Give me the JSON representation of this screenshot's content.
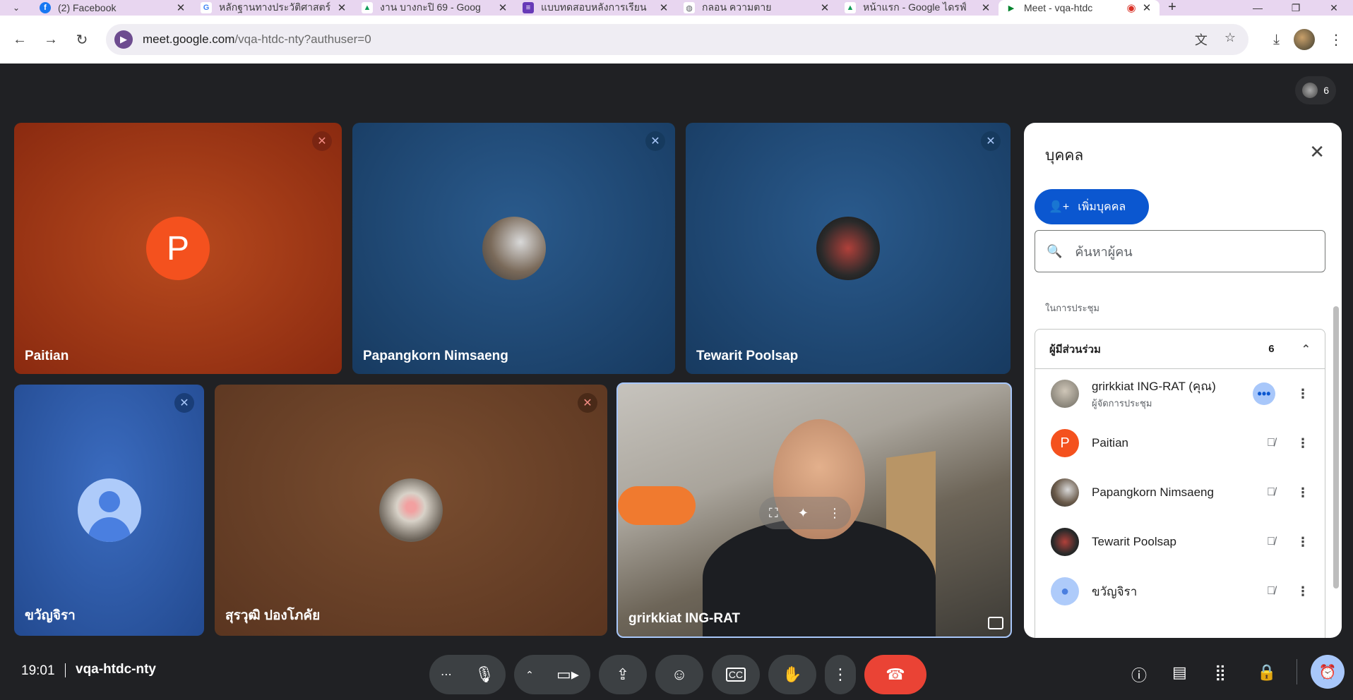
{
  "browser": {
    "tabs": [
      {
        "title": "(2) Facebook",
        "fav_color": "#1877f2",
        "fav_char": "f"
      },
      {
        "title": "หลักฐานทางประวัติศาสตร์",
        "fav_color": "#4285f4",
        "fav_char": "G"
      },
      {
        "title": "งาน บางกะปิ 69 - Goog",
        "fav_color": "#0f9d58",
        "fav_char": "▲"
      },
      {
        "title": "แบบทดสอบหลังการเรียน",
        "fav_color": "#673ab7",
        "fav_char": "≡"
      },
      {
        "title": "กลอน ความตาย",
        "fav_color": "#5f6368",
        "fav_char": "◍"
      },
      {
        "title": "หน้าแรก - Google ไดรฟ์",
        "fav_color": "#0f9d58",
        "fav_char": "▲"
      },
      {
        "title": "Meet - vqa-htdc",
        "fav_color": "#00832d",
        "fav_char": "▶",
        "active": true
      }
    ],
    "url_host": "meet.google.com",
    "url_path": "/vqa-htdc-nty?authuser=0"
  },
  "meeting": {
    "participant_count": "6",
    "time": "19:01",
    "code": "vqa-htdc-nty"
  },
  "tiles": [
    {
      "name": "Paitian",
      "letter": "P",
      "bg": "#b23c17"
    },
    {
      "name": "Papangkorn Nimsaeng",
      "bg": "#1f4a78"
    },
    {
      "name": "Tewarit Poolsap",
      "bg": "#1f4a78"
    },
    {
      "name": "ขวัญจิรา",
      "bg": "#2f5fb0"
    },
    {
      "name": "สุรวุฒิ ปองโภคัย",
      "bg": "#6a4128"
    },
    {
      "name": "grirkkiat ING-RAT"
    }
  ],
  "panel": {
    "title": "บุคคล",
    "add_label": "เพิ่มบุคคล",
    "search_placeholder": "ค้นหาผู้คน",
    "section_label": "ในการประชุม",
    "group_label": "ผู้มีส่วนร่วม",
    "group_count": "6",
    "people": [
      {
        "name": "grirkkiat ING-RAT (คุณ)",
        "role": "ผู้จัดการประชุม"
      },
      {
        "name": "Paitian",
        "letter": "P"
      },
      {
        "name": "Papangkorn Nimsaeng"
      },
      {
        "name": "Tewarit Poolsap"
      },
      {
        "name": "ขวัญจิรา"
      }
    ]
  }
}
